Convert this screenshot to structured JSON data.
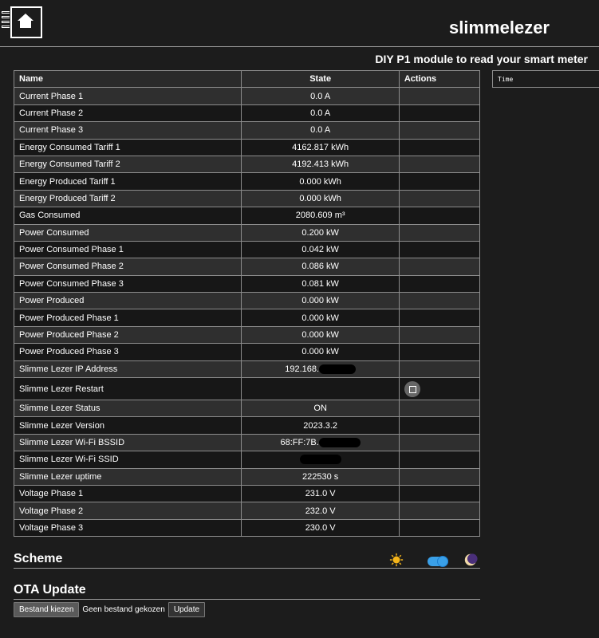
{
  "header": {
    "title": "slimmelezer",
    "subtitle": "DIY P1 module to read your smart meter",
    "logo_icon": "chip-house-icon"
  },
  "table": {
    "columns": {
      "name": "Name",
      "state": "State",
      "actions": "Actions"
    },
    "rows": [
      {
        "name": "Current Phase 1",
        "state": "0.0 A"
      },
      {
        "name": "Current Phase 2",
        "state": "0.0 A"
      },
      {
        "name": "Current Phase 3",
        "state": "0.0 A"
      },
      {
        "name": "Energy Consumed Tariff 1",
        "state": "4162.817 kWh"
      },
      {
        "name": "Energy Consumed Tariff 2",
        "state": "4192.413 kWh"
      },
      {
        "name": "Energy Produced Tariff 1",
        "state": "0.000 kWh"
      },
      {
        "name": "Energy Produced Tariff 2",
        "state": "0.000 kWh"
      },
      {
        "name": "Gas Consumed",
        "state": "2080.609 m³"
      },
      {
        "name": "Power Consumed",
        "state": "0.200 kW"
      },
      {
        "name": "Power Consumed Phase 1",
        "state": "0.042 kW"
      },
      {
        "name": "Power Consumed Phase 2",
        "state": "0.086 kW"
      },
      {
        "name": "Power Consumed Phase 3",
        "state": "0.081 kW"
      },
      {
        "name": "Power Produced",
        "state": "0.000 kW"
      },
      {
        "name": "Power Produced Phase 1",
        "state": "0.000 kW"
      },
      {
        "name": "Power Produced Phase 2",
        "state": "0.000 kW"
      },
      {
        "name": "Power Produced Phase 3",
        "state": "0.000 kW"
      },
      {
        "name": "Slimme Lezer IP Address",
        "state": "192.168."
      },
      {
        "name": "Slimme Lezer Restart",
        "state": ""
      },
      {
        "name": "Slimme Lezer Status",
        "state": "ON"
      },
      {
        "name": "Slimme Lezer Version",
        "state": "2023.3.2"
      },
      {
        "name": "Slimme Lezer Wi-Fi BSSID",
        "state": "68:FF:7B."
      },
      {
        "name": "Slimme Lezer Wi-Fi SSID",
        "state": ""
      },
      {
        "name": "Slimme Lezer uptime",
        "state": "222530 s"
      },
      {
        "name": "Voltage Phase 1",
        "state": "231.0 V"
      },
      {
        "name": "Voltage Phase 2",
        "state": "232.0 V"
      },
      {
        "name": "Voltage Phase 3",
        "state": "230.0 V"
      }
    ]
  },
  "log": {
    "header": "Time"
  },
  "scheme": {
    "title": "Scheme",
    "light_icon": "sun-icon",
    "dark_icon": "moon-icon",
    "dark_enabled": true
  },
  "ota": {
    "title": "OTA Update",
    "choose_label": "Bestand kiezen",
    "file_status": "Geen bestand gekozen",
    "update_label": "Update"
  },
  "colors": {
    "background": "#1c1c1c",
    "toggle_accent": "#3aa0e8",
    "sun": "#f5b51a",
    "moon": "#5a3a8c"
  }
}
